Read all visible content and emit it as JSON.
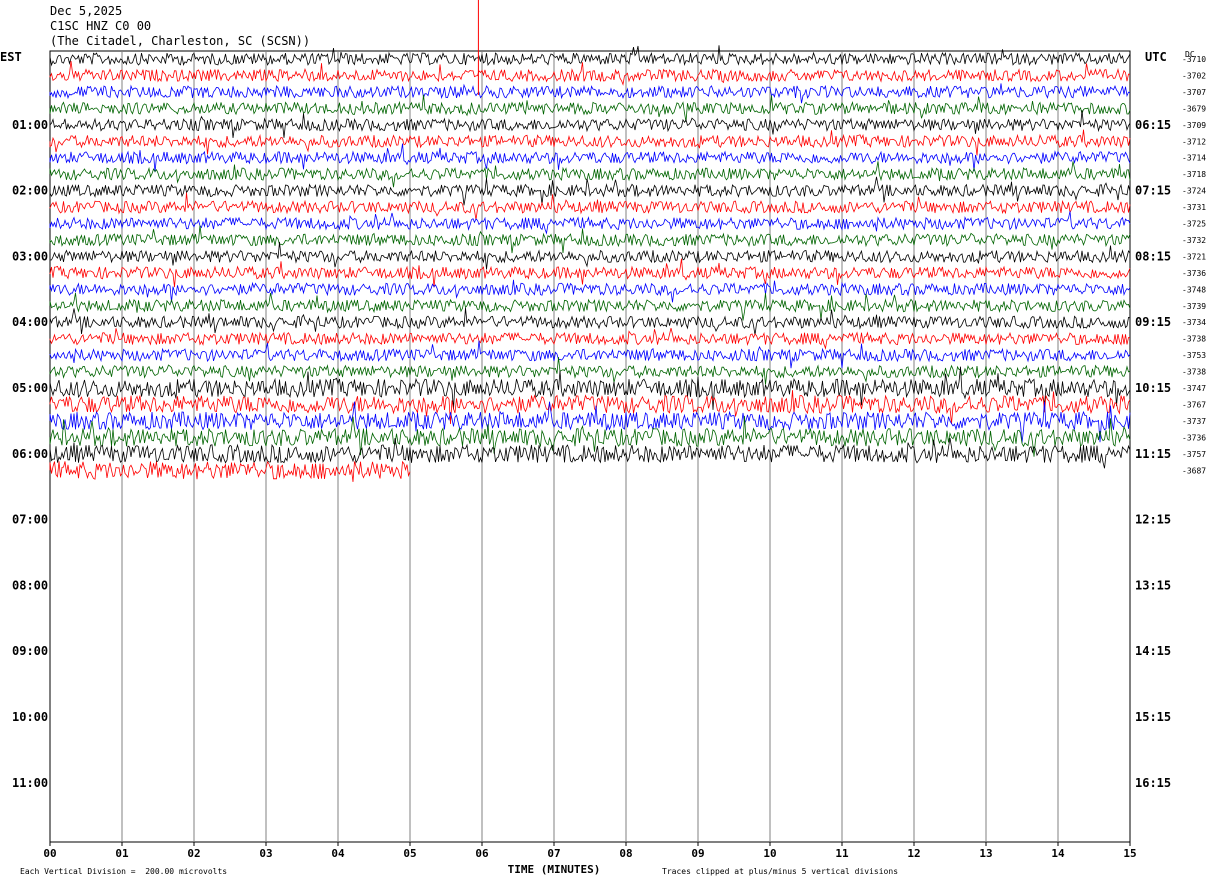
{
  "header": {
    "date": "Dec 5,2025",
    "station": "C1SC HNZ C0 00",
    "location": "(The Citadel, Charleston, SC (SCSN))"
  },
  "axis": {
    "left_label": "EST",
    "right_label": "UTC",
    "dc_label": "DC",
    "xlabel": "TIME (MINUTES)"
  },
  "footer": {
    "scale_note": "Each Vertical Division =  200.00 microvolts",
    "clip_note": "Traces clipped at plus/minus 5 vertical divisions"
  },
  "chart_data": {
    "type": "line",
    "x_ticks": [
      "00",
      "01",
      "02",
      "03",
      "04",
      "05",
      "06",
      "07",
      "08",
      "09",
      "10",
      "11",
      "12",
      "13",
      "14",
      "15"
    ],
    "xlim": [
      0,
      15
    ],
    "est_hours": [
      "01:00",
      "02:00",
      "03:00",
      "04:00",
      "05:00",
      "06:00",
      "07:00",
      "08:00",
      "09:00",
      "10:00",
      "11:00"
    ],
    "utc_hours": [
      "06:15",
      "07:15",
      "08:15",
      "09:15",
      "10:15",
      "11:15",
      "12:15",
      "13:15",
      "14:15",
      "15:15",
      "16:15"
    ],
    "trace_colors": [
      "#000000",
      "#ff0000",
      "#0000ff",
      "#006400"
    ],
    "dc_offsets": [
      "-3710",
      "-3702",
      "-3707",
      "-3679",
      "-3709",
      "-3712",
      "-3714",
      "-3718",
      "-3724",
      "-3731",
      "-3725",
      "-3732",
      "-3721",
      "-3736",
      "-3748",
      "-3739",
      "-3734",
      "-3738",
      "-3753",
      "-3738",
      "-3747",
      "-3767",
      "-3737",
      "-3736",
      "-3757",
      "-3687"
    ],
    "trace_rows": 26,
    "last_trace_end_minutes": 5.0
  }
}
